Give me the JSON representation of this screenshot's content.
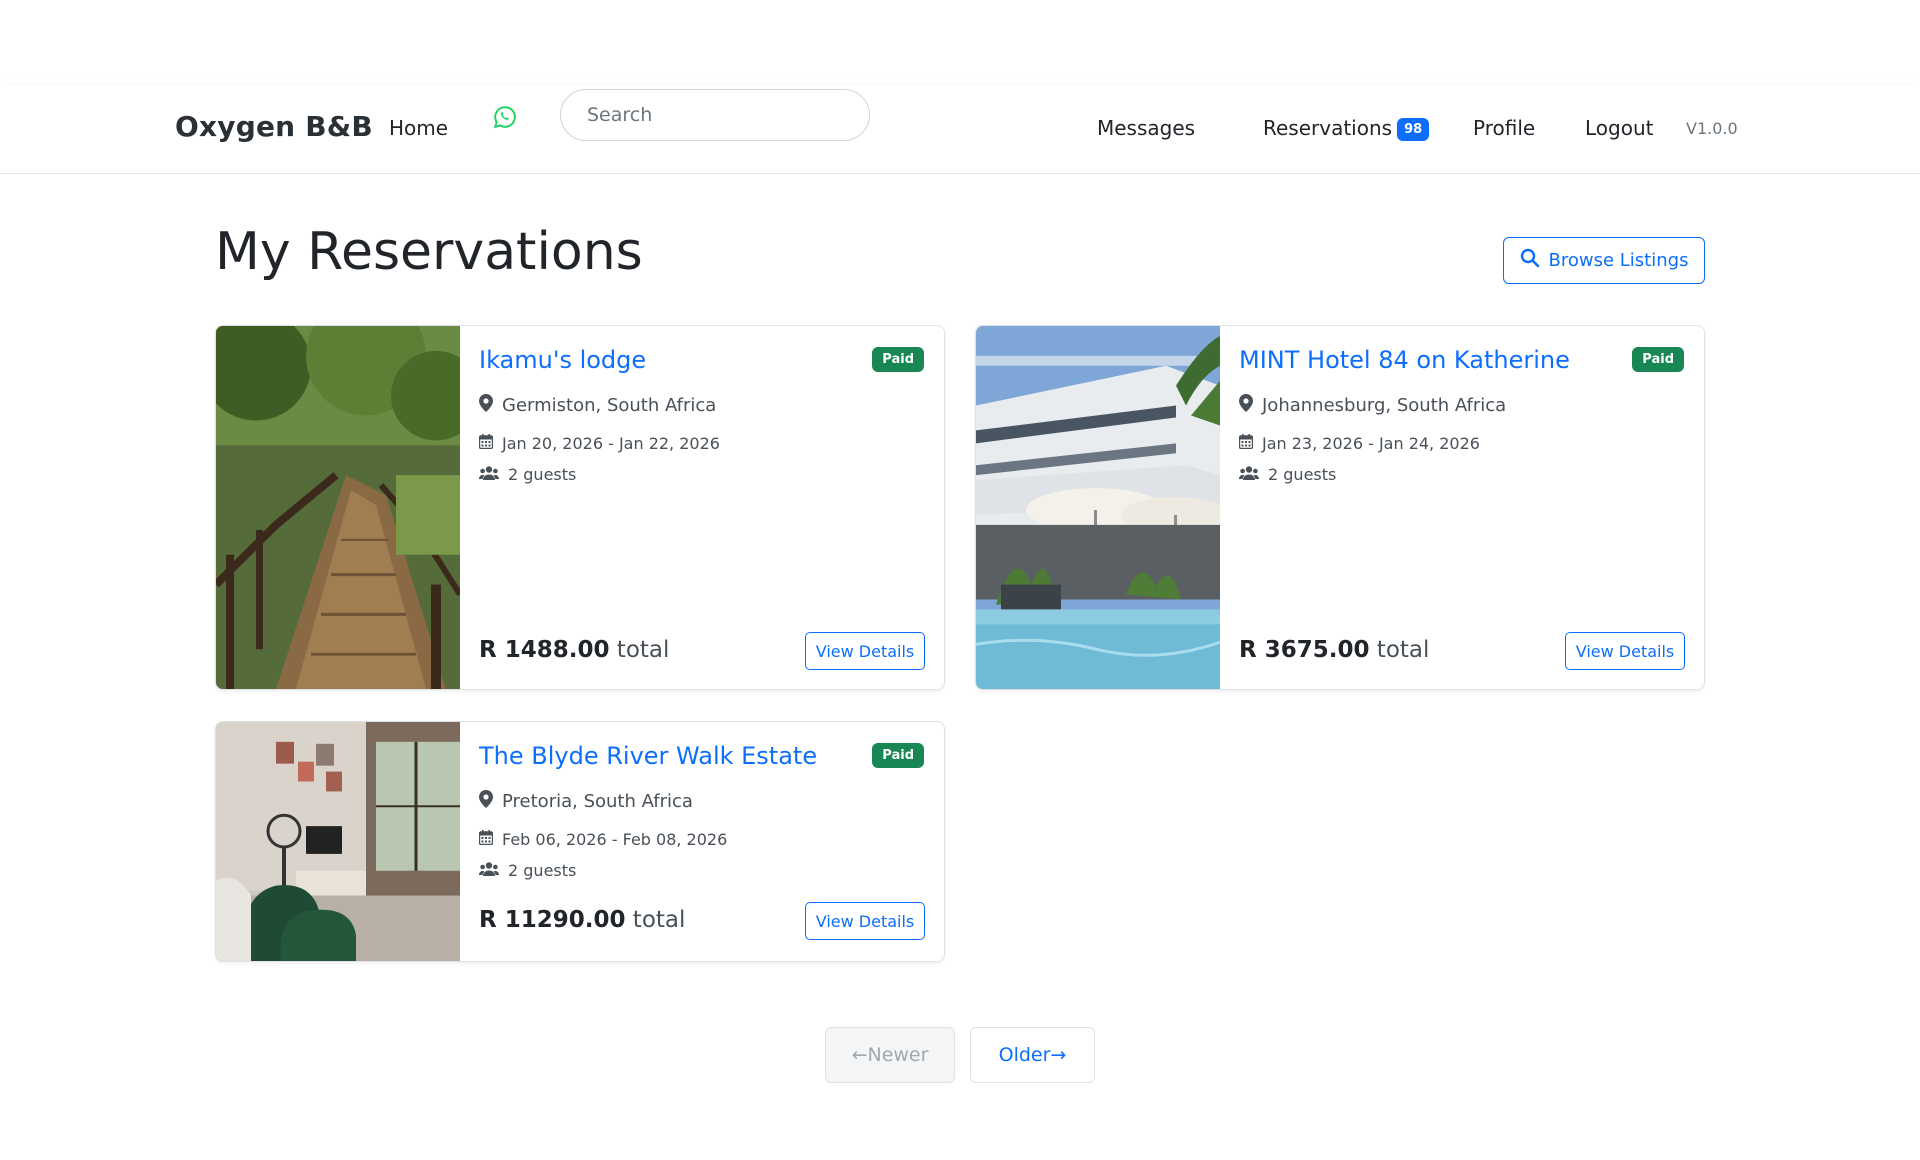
{
  "nav": {
    "brand": "Oxygen B&B",
    "home": "Home",
    "search_placeholder": "Search",
    "messages": "Messages",
    "reservations": "Reservations",
    "reservations_count": "98",
    "profile": "Profile",
    "logout": "Logout",
    "version": "V1.0.0"
  },
  "page": {
    "title": "My Reservations",
    "browse_label": "Browse Listings"
  },
  "reservations": [
    {
      "title": "Ikamu's lodge",
      "status": "Paid",
      "location": "Germiston, South Africa",
      "dates": "Jan 20, 2026 - Jan 22, 2026",
      "guests": "2 guests",
      "price": "R 1488.00",
      "total_label": "total",
      "button": "View Details"
    },
    {
      "title": "MINT Hotel 84 on Katherine",
      "status": "Paid",
      "location": "Johannesburg, South Africa",
      "dates": "Jan 23, 2026 - Jan 24, 2026",
      "guests": "2 guests",
      "price": "R 3675.00",
      "total_label": "total",
      "button": "View Details"
    },
    {
      "title": "The Blyde River Walk Estate",
      "status": "Paid",
      "location": "Pretoria, South Africa",
      "dates": "Feb 06, 2026 - Feb 08, 2026",
      "guests": "2 guests",
      "price": "R 11290.00",
      "total_label": "total",
      "button": "View Details"
    }
  ],
  "pagination": {
    "newer": "←Newer",
    "older": "Older→"
  },
  "colors": {
    "primary": "#0d6efd",
    "paid": "#198754",
    "whatsapp": "#25d366"
  },
  "icons": [
    "whatsapp-icon",
    "search-icon",
    "map-pin-icon",
    "calendar-icon",
    "users-icon"
  ]
}
